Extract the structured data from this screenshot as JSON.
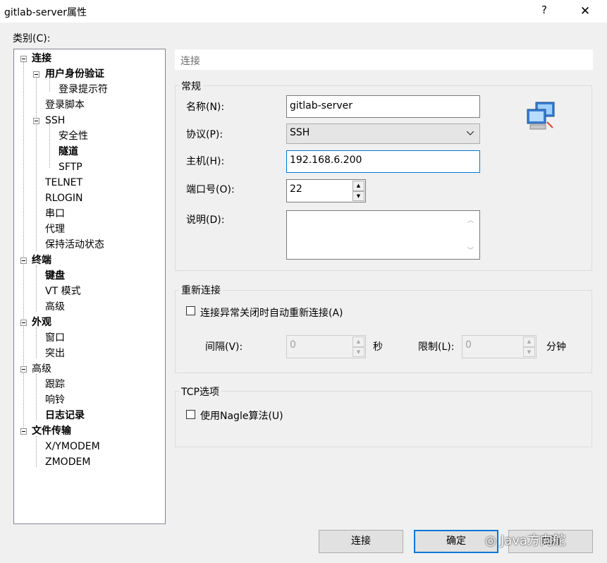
{
  "window": {
    "title": "gitlab-server属性",
    "help_glyph": "?",
    "close_glyph": "✕"
  },
  "categories_label": "类别(C):",
  "tree": [
    {
      "label": "连接",
      "bold": true
    },
    {
      "label": "用户身份验证",
      "bold": true
    },
    {
      "label": "登录提示符",
      "bold": false
    },
    {
      "label": "登录脚本",
      "bold": false
    },
    {
      "label": "SSH",
      "bold": false
    },
    {
      "label": "安全性",
      "bold": false
    },
    {
      "label": "隧道",
      "bold": true
    },
    {
      "label": "SFTP",
      "bold": false
    },
    {
      "label": "TELNET",
      "bold": false
    },
    {
      "label": "RLOGIN",
      "bold": false
    },
    {
      "label": "串口",
      "bold": false
    },
    {
      "label": "代理",
      "bold": false
    },
    {
      "label": "保持活动状态",
      "bold": false
    },
    {
      "label": "终端",
      "bold": true
    },
    {
      "label": "键盘",
      "bold": true
    },
    {
      "label": "VT 模式",
      "bold": false
    },
    {
      "label": "高级",
      "bold": false
    },
    {
      "label": "外观",
      "bold": true
    },
    {
      "label": "窗口",
      "bold": false
    },
    {
      "label": "突出",
      "bold": false
    },
    {
      "label": "高级",
      "bold": false
    },
    {
      "label": "跟踪",
      "bold": false
    },
    {
      "label": "响铃",
      "bold": false
    },
    {
      "label": "日志记录",
      "bold": true
    },
    {
      "label": "文件传输",
      "bold": true
    },
    {
      "label": "X/YMODEM",
      "bold": false
    },
    {
      "label": "ZMODEM",
      "bold": false
    }
  ],
  "panel": {
    "header": "连接",
    "general": {
      "title": "常规",
      "name_label": "名称(N):",
      "name_value": "gitlab-server",
      "protocol_label": "协议(P):",
      "protocol_value": "SSH",
      "host_label": "主机(H):",
      "host_value": "192.168.6.200",
      "port_label": "端口号(O):",
      "port_value": "22",
      "desc_label": "说明(D):",
      "desc_value": ""
    },
    "reconnect": {
      "title": "重新连接",
      "auto_reconnect_label": "连接异常关闭时自动重新连接(A)",
      "interval_label": "间隔(V):",
      "interval_value": "0",
      "interval_unit": "秒",
      "limit_label": "限制(L):",
      "limit_value": "0",
      "limit_unit": "分钟"
    },
    "tcp": {
      "title": "TCP选项",
      "nagle_label": "使用Nagle算法(U)"
    }
  },
  "buttons": {
    "connect": "连接",
    "ok": "确定",
    "cancel": "取消"
  },
  "watermark": "Java方向舵"
}
